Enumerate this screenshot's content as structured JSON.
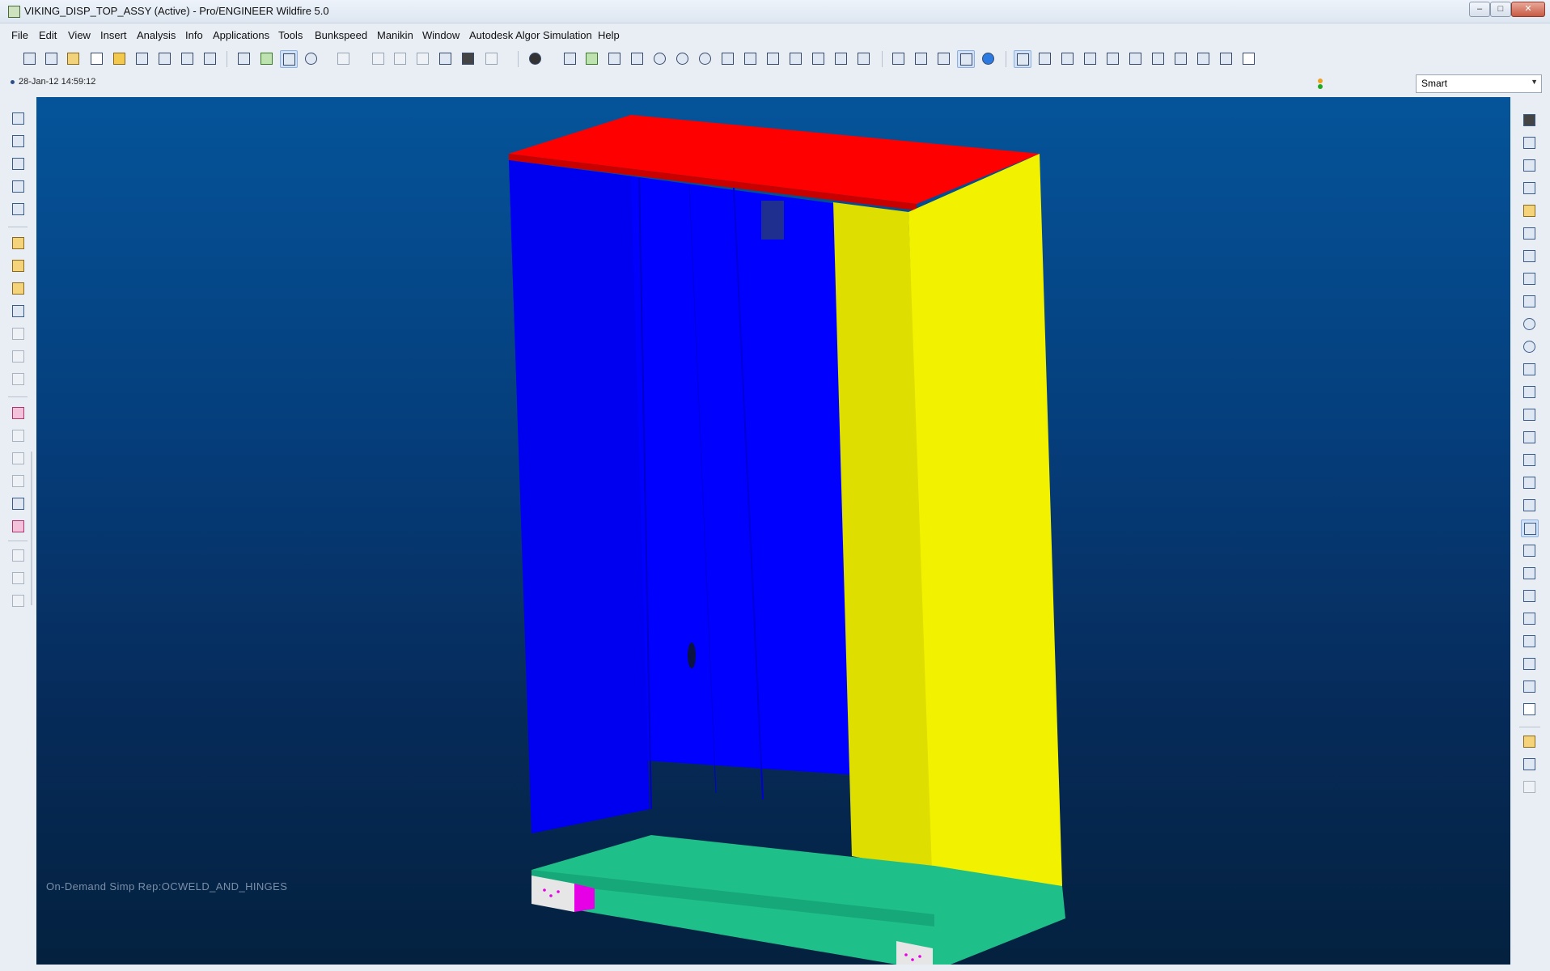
{
  "window": {
    "title": "VIKING_DISP_TOP_ASSY (Active) - Pro/ENGINEER Wildfire 5.0",
    "controls": {
      "minimize": "–",
      "maximize": "□",
      "close": "✕"
    }
  },
  "menu": {
    "items": [
      "File",
      "Edit",
      "View",
      "Insert",
      "Analysis",
      "Info",
      "Applications",
      "Tools",
      "Bunkspeed",
      "Manikin",
      "Window",
      "Autodesk Algor Simulation",
      "Help"
    ]
  },
  "status": {
    "timestamp": "28-Jan-12 14:59:12",
    "filter_value": "Smart",
    "filter_arrow": "▼"
  },
  "viewport": {
    "simp_rep_label": "On-Demand Simp Rep:OCWELD_AND_HINGES",
    "colors": {
      "top": "#ff0000",
      "side_blue": "#0000ff",
      "side_yellow": "#f2f200",
      "base": "#1fbf8a",
      "feet": "#e6e6e6",
      "accent": "#e600e6"
    }
  },
  "toolbar": {
    "icons": [
      "new-window-icon",
      "close-window-icon",
      "regenerate-icon",
      "new-file-icon",
      "open-file-icon",
      "save-icon",
      "save-as-icon",
      "print-icon",
      "print-preview-icon",
      "render-icon",
      "sketch-icon",
      "edit-definition-icon",
      "undo-icon",
      "redo-icon",
      "cut-icon",
      "copy-icon",
      "paste-icon",
      "paste-special-icon",
      "find-icon",
      "select-box-icon",
      "shading-icon",
      "refit-icon",
      "orient-icon",
      "spin-center-icon",
      "pan-icon",
      "zoom-in-icon",
      "zoom-out-icon",
      "zoom-fit-icon",
      "named-views-icon",
      "layers-icon",
      "view-manager-icon",
      "model-tree-icon",
      "layer-display-icon",
      "wireframe-icon",
      "hidden-line-icon",
      "no-hidden-icon",
      "shaded-icon",
      "enhanced-realism-icon",
      "datum-planes-icon",
      "datum-axes-icon",
      "datum-points-icon",
      "coord-sys-icon",
      "annotations-icon",
      "spin-center-toggle-icon",
      "plane-tags-icon",
      "point-tags-icon",
      "close-icon"
    ]
  }
}
